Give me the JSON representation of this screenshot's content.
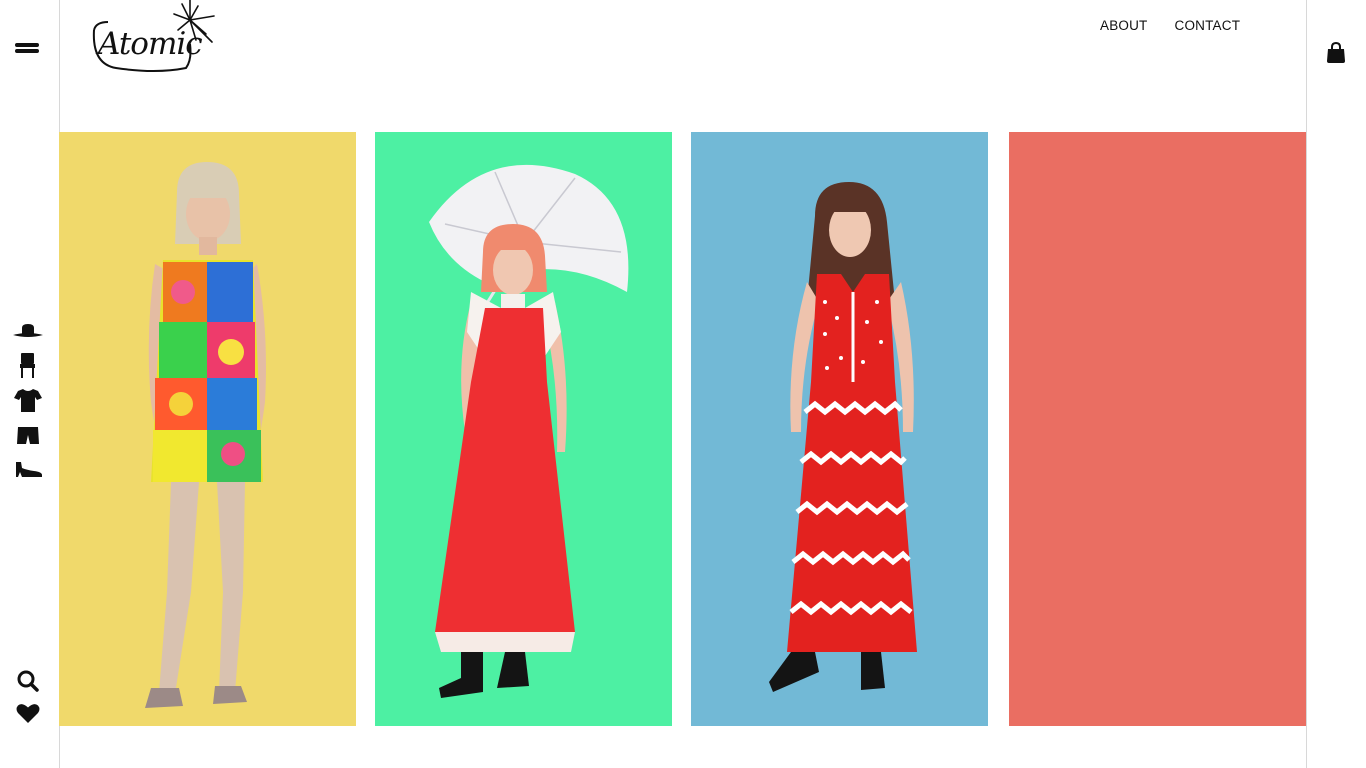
{
  "header": {
    "logo_text": "Atomic",
    "nav": [
      {
        "label": "ABOUT"
      },
      {
        "label": "CONTACT"
      }
    ]
  },
  "sidebar": {
    "categories": [
      {
        "icon": "hat-icon"
      },
      {
        "icon": "chair-icon"
      },
      {
        "icon": "shirt-icon"
      },
      {
        "icon": "shorts-icon"
      },
      {
        "icon": "shoe-icon"
      }
    ],
    "utilities": [
      {
        "icon": "search-icon"
      },
      {
        "icon": "heart-icon"
      }
    ]
  },
  "products": [
    {
      "bg_color": "#f0d96b",
      "image": "model-in-floral-patchwork-mini-dress"
    },
    {
      "bg_color": "#4df0a3",
      "image": "model-in-red-ruffle-maxi-dress-with-parasol"
    },
    {
      "bg_color": "#72b9d6",
      "image": "model-in-red-white-zigzag-maxi-dress"
    },
    {
      "bg_color": "#ea6e62",
      "image": ""
    }
  ]
}
